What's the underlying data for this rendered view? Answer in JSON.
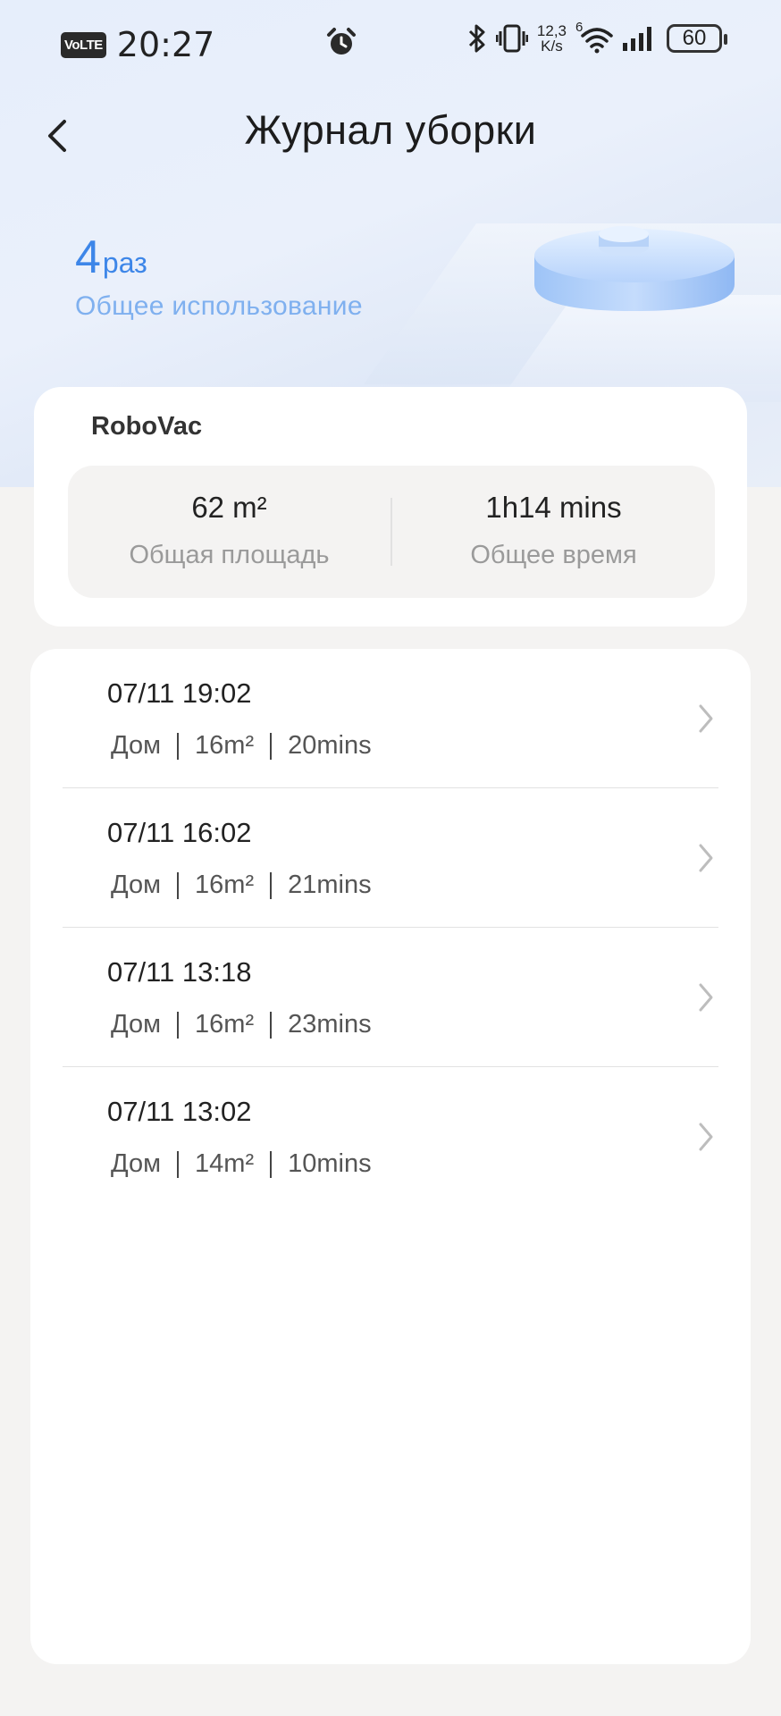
{
  "status_bar": {
    "network_badge": "VoLTE",
    "time": "20:27",
    "net_speed_value": "12,3",
    "net_speed_unit": "K/s",
    "wifi_badge": "6",
    "battery": "60"
  },
  "header": {
    "title": "Журнал уборки"
  },
  "usage": {
    "count": "4",
    "unit": "раз",
    "label": "Общее использование"
  },
  "summary": {
    "device_name": "RoboVac",
    "area_value": "62 m²",
    "area_label": "Общая площадь",
    "time_value": "1h14 mins",
    "time_label": "Общее время"
  },
  "logs": [
    {
      "datetime": "07/11 19:02",
      "room": "Дом",
      "area": "16m²",
      "duration": "20mins"
    },
    {
      "datetime": "07/11 16:02",
      "room": "Дом",
      "area": "16m²",
      "duration": "21mins"
    },
    {
      "datetime": "07/11 13:18",
      "room": "Дом",
      "area": "16m²",
      "duration": "23mins"
    },
    {
      "datetime": "07/11 13:02",
      "room": "Дом",
      "area": "14m²",
      "duration": "10mins"
    }
  ],
  "icons": {
    "back": "chevron-left-icon",
    "alarm": "alarm-icon",
    "bluetooth": "bluetooth-icon",
    "vibrate": "vibrate-icon",
    "wifi": "wifi-icon",
    "signal": "signal-icon",
    "row_chevron": "chevron-right-icon"
  },
  "colors": {
    "accent": "#3d86e8",
    "accent_light": "#7fb0ef",
    "background": "#f4f3f2",
    "card": "#ffffff"
  }
}
